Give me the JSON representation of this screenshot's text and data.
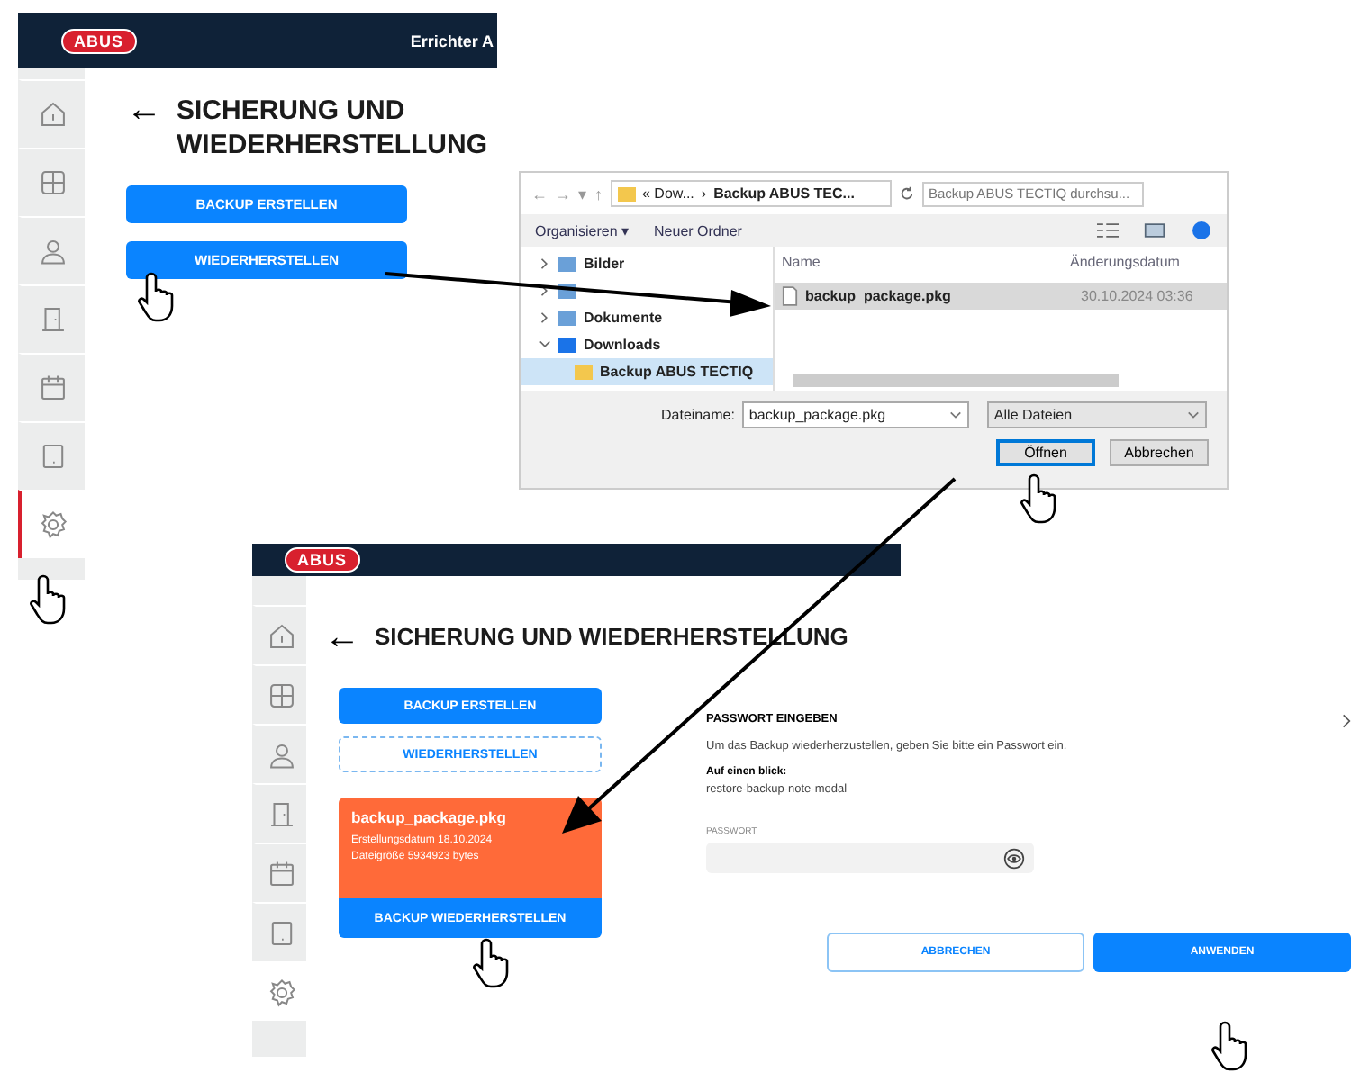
{
  "app_screen": {
    "logo": "ABUS",
    "user": "Errichter A",
    "sidebar": {
      "items": [
        {
          "selected": false
        },
        {
          "selected": false
        },
        {
          "selected": false
        },
        {
          "selected": false
        },
        {
          "selected": false
        },
        {
          "selected": false
        },
        {
          "selected": true
        }
      ]
    },
    "back": "←",
    "title_lines": [
      "SICHERUNG UND",
      "WIEDERHERSTELLUNG"
    ],
    "buttons": [
      {
        "label": "BACKUP ERSTELLEN",
        "kind": "solid"
      },
      {
        "label": "WIEDERHERSTELLEN",
        "kind": "solid"
      }
    ]
  },
  "file_dialog": {
    "nav": [
      "←",
      "→",
      "▾",
      "↑"
    ],
    "path": [
      "« Dow...",
      "›",
      "Backup ABUS TEC..."
    ],
    "search": {
      "placeholder": "Backup ABUS TECTIQ durchsu..."
    },
    "toolbar": [
      "Organisieren ▾",
      "Neuer Ordner"
    ],
    "tree": [
      {
        "label": "Bilder",
        "expanded": false,
        "selected": false
      },
      {
        "expanded": false,
        "selected": false
      },
      {
        "label": "Dokumente",
        "expanded": false,
        "selected": false
      },
      {
        "label": "Downloads",
        "expanded": true,
        "selected": false,
        "children": [
          {
            "label": "Backup ABUS TECTIQ",
            "selected": true
          }
        ]
      }
    ],
    "columns": [
      "Name",
      "Änderungsdatum"
    ],
    "files": [
      {
        "name": "backup_package.pkg",
        "date": "30.10.2024 03:36",
        "selected": true
      }
    ],
    "filename_label": "Dateiname:",
    "filename": "backup_package.pkg",
    "filter": "Alle Dateien",
    "buttons": [
      {
        "label": "Öffnen",
        "kind": "default"
      },
      {
        "label": "Abbrechen",
        "kind": "normal"
      }
    ]
  },
  "restore_screen": {
    "logo": "ABUS",
    "sidebar": {
      "items": [
        {
          "selected": false
        },
        {
          "selected": false
        },
        {
          "selected": false
        },
        {
          "selected": false
        },
        {
          "selected": false
        },
        {
          "selected": false
        },
        {
          "selected": true
        }
      ]
    },
    "back": "←",
    "title": "SICHERUNG UND WIEDERHERSTELLUNG",
    "buttons": [
      {
        "label": "BACKUP ERSTELLEN",
        "kind": "solid"
      },
      {
        "label": "WIEDERHERSTELLEN",
        "kind": "outline"
      }
    ],
    "backup_card": {
      "file": "backup_package.pkg",
      "created": "Erstellungsdatum 18.10.2024",
      "size": "Dateigröße 5934923 bytes",
      "button": "BACKUP WIEDERHERSTELLEN"
    }
  },
  "password_modal": {
    "title": "PASSWORT EINGEBEN",
    "text": "Um das Backup wiederherzustellen, geben Sie bitte ein Passwort ein.",
    "note_title": "Auf einen blick:",
    "note": "restore-backup-note-modal",
    "field_label": "PASSWORT",
    "buttons": [
      {
        "label": "ABBRECHEN",
        "kind": "outline"
      },
      {
        "label": "ANWENDEN",
        "kind": "solid"
      }
    ]
  }
}
